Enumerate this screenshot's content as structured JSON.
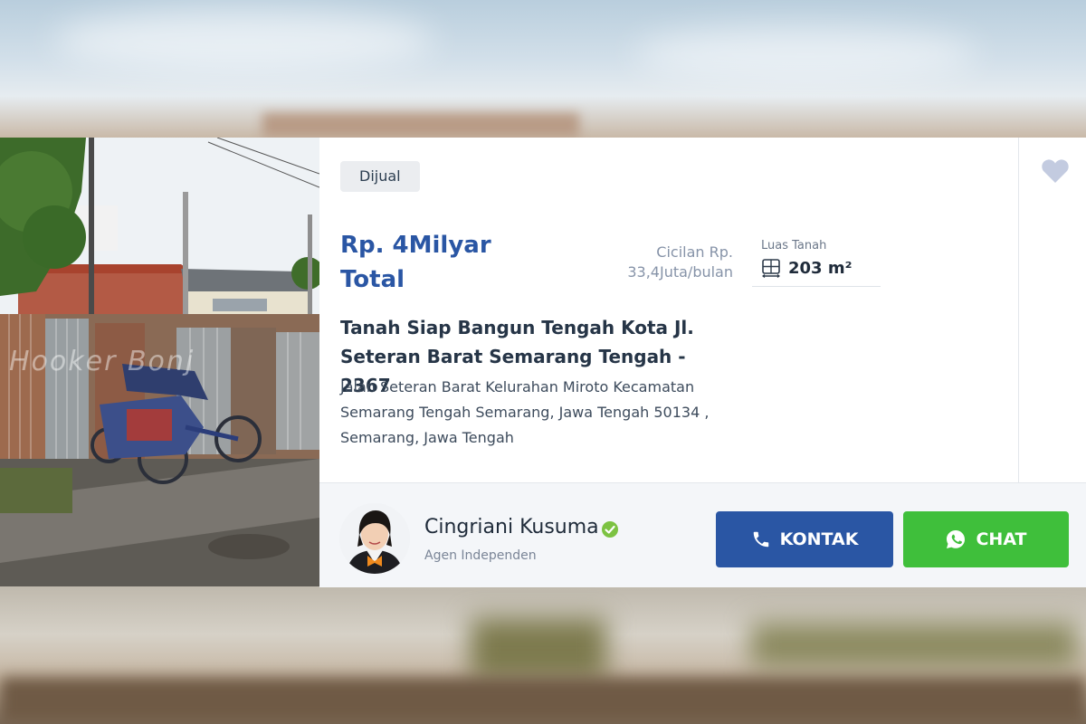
{
  "listing": {
    "status_badge": "Dijual",
    "price_line1": "Rp. 4Milyar",
    "price_line2": "Total",
    "installment_line1": "Cicilan Rp.",
    "installment_line2": "33,4Juta/bulan",
    "land_area_label": "Luas Tanah",
    "land_area_value": "203 m²",
    "title_line1": "Tanah Siap Bangun Tengah Kota Jl.",
    "title_line2": "Seteran Barat Semarang Tengah - 2367",
    "address_line1": "Jalan Seteran Barat Kelurahan Miroto Kecamatan",
    "address_line2": "Semarang Tengah Semarang, Jawa Tengah 50134 ,",
    "address_line3": "Semarang, Jawa Tengah",
    "photo_watermark": "Hooker Bonj"
  },
  "agent": {
    "name": "Cingriani Kusuma",
    "role": "Agen Independen"
  },
  "actions": {
    "contact_label": "KONTAK",
    "chat_label": "CHAT"
  },
  "icons": {
    "favorite": "heart-icon",
    "land_area": "land-area-icon",
    "verified": "verified-check-icon",
    "phone": "phone-icon",
    "whatsapp": "whatsapp-icon"
  },
  "colors": {
    "primary_blue": "#2a56a4",
    "chat_green": "#3fbf3b",
    "verified_green": "#7cc242",
    "heart_gray": "#c3cbe0"
  }
}
